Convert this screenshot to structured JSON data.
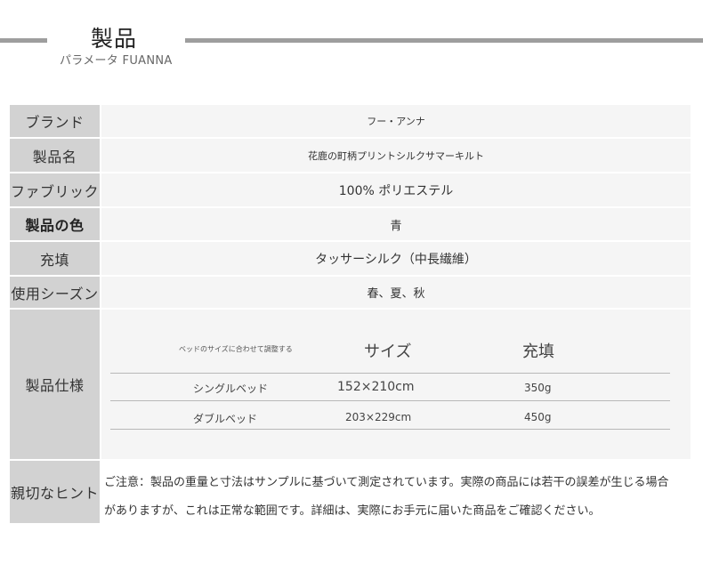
{
  "header": {
    "title": "製品",
    "subtitle": "パラメータ FUANNA"
  },
  "rows": {
    "brand": {
      "label": "ブランド",
      "value": "フー・アンナ"
    },
    "name": {
      "label": "製品名",
      "value": "花鹿の町柄プリントシルクサマーキルト"
    },
    "fabric": {
      "label": "ファブリック",
      "value": "100% ポリエステル"
    },
    "color": {
      "label": "製品の色",
      "value": "青"
    },
    "filling": {
      "label": "充填",
      "value": "タッサーシルク（中長繊維）"
    },
    "season": {
      "label": "使用シーズン",
      "value": "春、夏、秋"
    }
  },
  "spec": {
    "label": "製品仕様",
    "header": {
      "col1": "ベッドのサイズに合わせて調整する",
      "col2": "サイズ",
      "col3": "充填"
    },
    "rows": [
      {
        "bed": "シングルベッド",
        "size": "152×210cm",
        "fill": "350g"
      },
      {
        "bed": "ダブルベッド",
        "size": "203×229cm",
        "fill": "450g"
      }
    ]
  },
  "note": {
    "label": "親切なヒント",
    "line1": "ご注意：製品の重量と寸法はサンプルに基づいて測定されています。実際の商品には若干の誤差が生じる場合",
    "line2": "がありますが、これは正常な範囲です。詳細は、実際にお手元に届いた商品をご確認ください。"
  }
}
